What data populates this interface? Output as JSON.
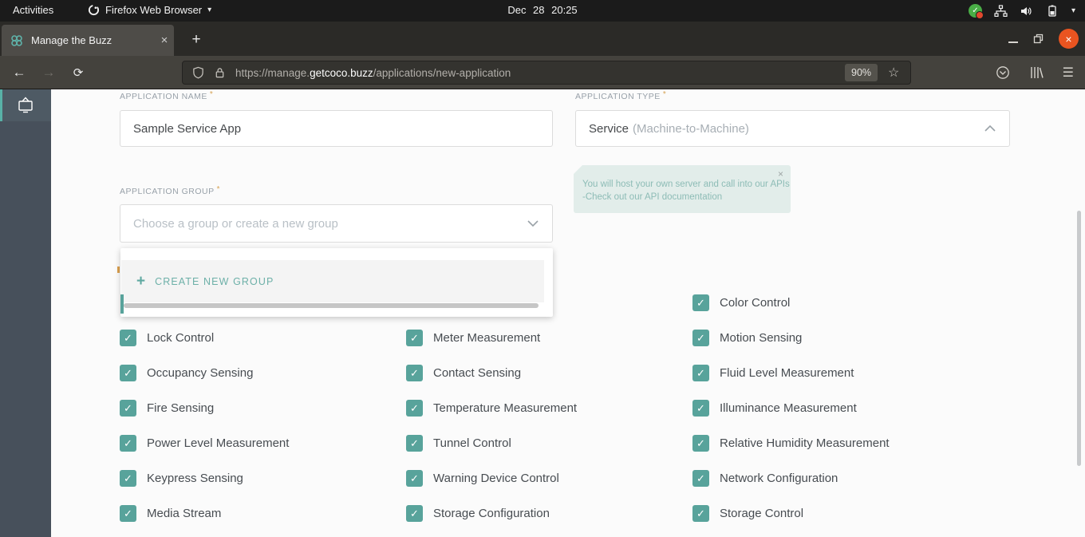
{
  "system_bar": {
    "activities": "Activities",
    "app_menu": "Firefox Web Browser",
    "caret": "▾",
    "clock": "Dec 28 20:25"
  },
  "browser": {
    "tab_title": "Manage the Buzz",
    "url": {
      "scheme_subdomain": "https://manage.",
      "domain": "getcoco.buzz",
      "path": "/applications/new-application"
    },
    "zoom_badge": "90%"
  },
  "glyphs": {
    "back": "←",
    "forward": "→",
    "reload": "⟳",
    "star": "☆",
    "menu": "☰",
    "minimize": "–",
    "close": "×",
    "tab_close": "×",
    "new_tab": "+",
    "plus": "+",
    "check": "✓",
    "tooltip_close": "×"
  },
  "page": {
    "form": {
      "application_name": {
        "label": "APPLICATION NAME",
        "required_mark": "*",
        "value": "Sample Service App"
      },
      "application_type": {
        "label": "APPLICATION TYPE",
        "required_mark": "*",
        "value": "Service",
        "value_note": "(Machine-to-Machine)"
      },
      "type_tooltip": {
        "line1": "You will host your own server and call into our APIs",
        "line2": "-Check out our API documentation"
      },
      "application_group": {
        "label": "APPLICATION GROUP",
        "required_mark": "*",
        "placeholder": "Choose a group or create a new group"
      },
      "group_dropdown": {
        "create_new_group": "CREATE NEW GROUP"
      }
    },
    "capabilities": {
      "items": [
        {
          "label": "Color Control"
        },
        {
          "label": "Lock Control"
        },
        {
          "label": "Meter Measurement"
        },
        {
          "label": "Motion Sensing"
        },
        {
          "label": "Occupancy Sensing"
        },
        {
          "label": "Contact Sensing"
        },
        {
          "label": "Fluid Level Measurement"
        },
        {
          "label": "Fire Sensing"
        },
        {
          "label": "Temperature Measurement"
        },
        {
          "label": "Illuminance Measurement"
        },
        {
          "label": "Power Level Measurement"
        },
        {
          "label": "Tunnel Control"
        },
        {
          "label": "Relative Humidity Measurement"
        },
        {
          "label": "Keypress Sensing"
        },
        {
          "label": "Warning Device Control"
        },
        {
          "label": "Network Configuration"
        },
        {
          "label": "Media Stream"
        },
        {
          "label": "Storage Configuration"
        },
        {
          "label": "Storage Control"
        }
      ]
    }
  }
}
